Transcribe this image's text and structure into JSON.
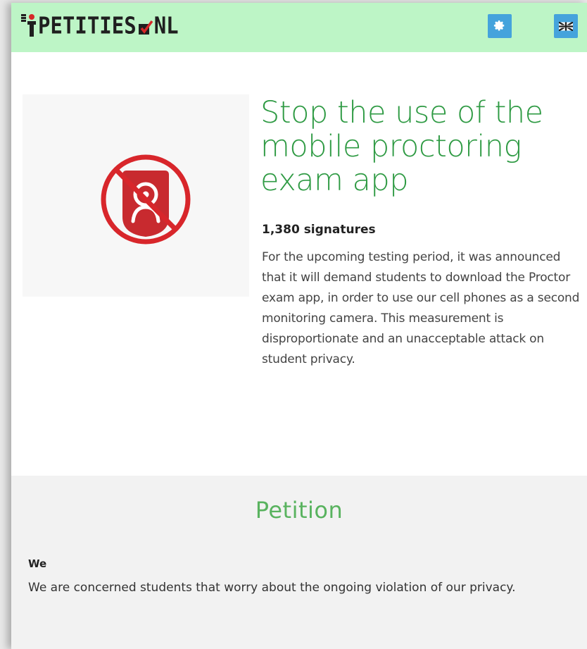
{
  "header": {
    "logo_text_left": "PETITIES",
    "logo_text_right": "NL",
    "settings_icon": "gear-icon",
    "language_icon": "uk-flag-icon",
    "background_color": "#bdf5c6",
    "button_color": "#45a3dc"
  },
  "petition": {
    "image_icon": "no-camera-proctoring-icon",
    "title": "Stop the use of the mobile proctoring exam app",
    "signatures": "1,380 signatures",
    "summary": "For the upcoming testing period, it was announced that it will demand students to download the Proctor exam app, in order to use our cell phones as a second monitoring camera. This measurement is disproportionate and an unacceptable attack on student privacy.",
    "title_color": "#2e9a43"
  },
  "section": {
    "heading": "Petition",
    "we_label": "We",
    "we_text": "We are concerned students that worry about the ongoing violation of our privacy.",
    "heading_color": "#59b35f"
  }
}
